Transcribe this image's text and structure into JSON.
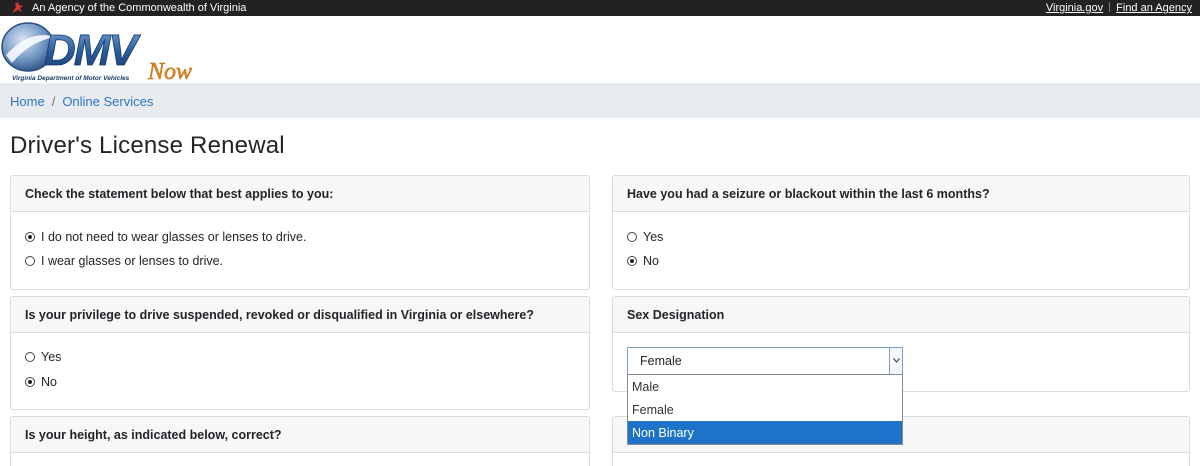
{
  "topbar": {
    "agency_text": "An Agency of the Commonwealth of Virginia",
    "link_virginia": "Virginia.gov",
    "link_find_agency": "Find an Agency"
  },
  "logo": {
    "dmv_text": "DMV",
    "tagline": "Virginia Department of Motor Vehicles",
    "now_text": "Now"
  },
  "breadcrumb": {
    "home": "Home",
    "separator": "/",
    "online_services": "Online Services"
  },
  "page_title": "Driver's License Renewal",
  "cards": {
    "glasses": {
      "question": "Check the statement below that best applies to you:",
      "options": [
        "I do not need to wear glasses or lenses to drive.",
        "I wear glasses or lenses to drive."
      ],
      "selected_index": 0
    },
    "seizure": {
      "question": "Have you had a seizure or blackout within the last 6 months?",
      "options": [
        "Yes",
        "No"
      ],
      "selected_index": 1
    },
    "privilege": {
      "question": "Is your privilege to drive suspended, revoked or disqualified in Virginia or elsewhere?",
      "options": [
        "Yes",
        "No"
      ],
      "selected_index": 1
    },
    "sex": {
      "question": "Sex Designation",
      "selected_value": "Female",
      "options": [
        "Male",
        "Female",
        "Non Binary"
      ],
      "highlighted_option": "Non Binary"
    },
    "height": {
      "question": "Is your height, as indicated below, correct?"
    }
  },
  "colors": {
    "topbar_bg": "#222222",
    "link_blue": "#2d74c4",
    "breadcrumb_bg": "#e9ecef",
    "dropdown_highlight": "#1e73c9",
    "logo_orange": "#e8891c"
  }
}
